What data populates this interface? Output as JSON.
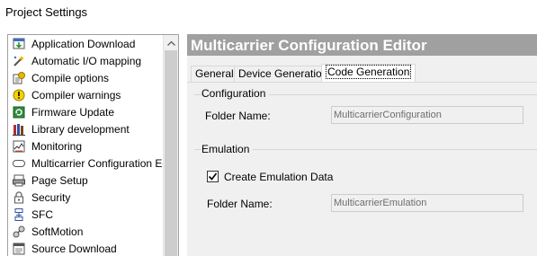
{
  "window": {
    "title": "Project Settings"
  },
  "sidebar": {
    "items": [
      {
        "label": "Application Download",
        "icon": "download-icon"
      },
      {
        "label": "Automatic I/O mapping",
        "icon": "io-mapping-icon"
      },
      {
        "label": "Compile options",
        "icon": "compile-options-icon"
      },
      {
        "label": "Compiler warnings",
        "icon": "warning-icon"
      },
      {
        "label": "Firmware Update",
        "icon": "firmware-icon"
      },
      {
        "label": "Library development",
        "icon": "library-icon"
      },
      {
        "label": "Monitoring",
        "icon": "monitoring-icon"
      },
      {
        "label": "Multicarrier Configuration Editor",
        "icon": "multicarrier-icon",
        "selected": true
      },
      {
        "label": "Page Setup",
        "icon": "page-setup-icon"
      },
      {
        "label": "Security",
        "icon": "lock-icon"
      },
      {
        "label": "SFC",
        "icon": "sfc-icon"
      },
      {
        "label": "SoftMotion",
        "icon": "softmotion-icon"
      },
      {
        "label": "Source Download",
        "icon": "source-download-icon"
      }
    ]
  },
  "editor": {
    "title": "Multicarrier Configuration Editor",
    "tabs": [
      {
        "label": "General"
      },
      {
        "label": "Device Generation"
      },
      {
        "label": "Code Generation",
        "active": true
      }
    ],
    "configuration": {
      "group_title": "Configuration",
      "folder_label": "Folder Name:",
      "folder_value": "MulticarrierConfiguration"
    },
    "emulation": {
      "group_title": "Emulation",
      "create_label": "Create Emulation Data",
      "create_checked": true,
      "folder_label": "Folder Name:",
      "folder_value": "MulticarrierEmulation"
    }
  },
  "colors": {
    "header_bg": "#a0a0a0",
    "panel_bg": "#f0f0f0"
  }
}
